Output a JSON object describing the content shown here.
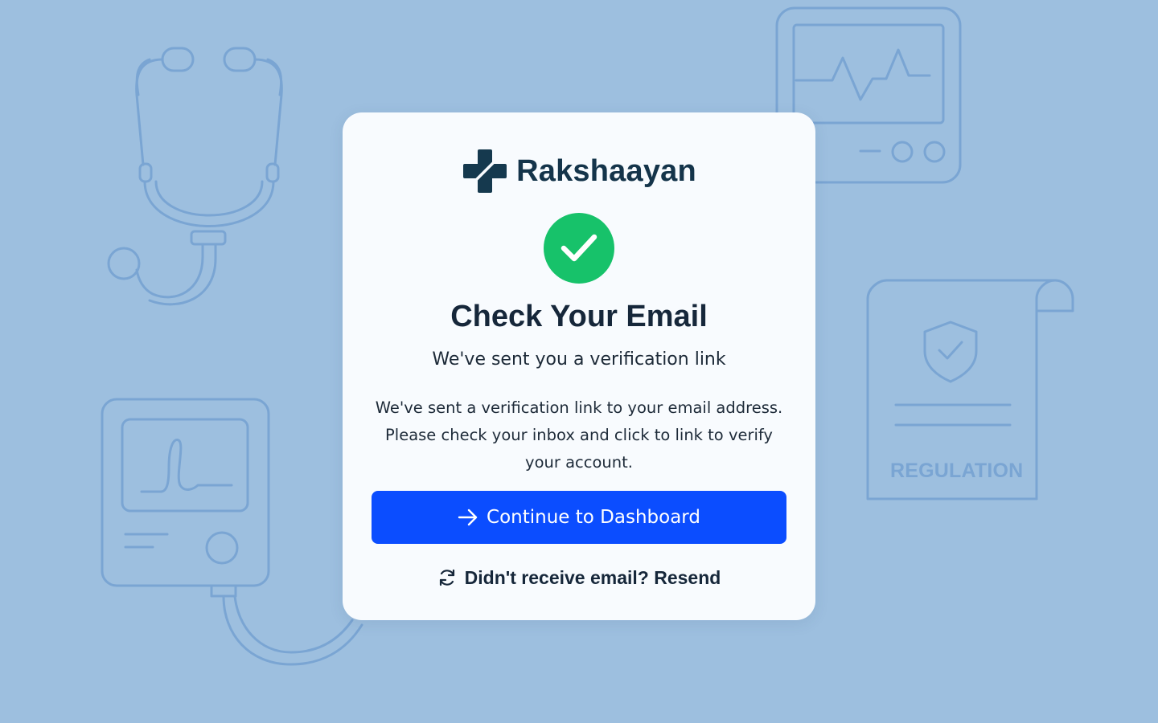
{
  "brand": {
    "name": "Rakshaayan",
    "logo_icon": "medical-cross-icon",
    "logo_color": "#15394e"
  },
  "status": {
    "icon": "check-circle-icon",
    "color": "#17c26a"
  },
  "heading": {
    "title": "Check Your Email",
    "subtitle": "We've sent you a verification link"
  },
  "message": {
    "line1": "We've sent a verification link to your email address.",
    "line2": "Please check your inbox and click to link to verify",
    "line3": "your account."
  },
  "actions": {
    "continue_label": "Continue to Dashboard",
    "continue_icon": "arrow-right-icon",
    "resend_label": "Didn't receive email? Resend",
    "resend_icon": "refresh-icon"
  },
  "background": {
    "regulation_label": "REGULATION",
    "illustrations": [
      "stethoscope-icon",
      "heart-monitor-icon",
      "regulation-document-icon",
      "ecg-device-icon"
    ]
  },
  "colors": {
    "page_background": "#9dbfdf",
    "card_background": "#f8fbfe",
    "primary_button": "#0b4dff",
    "illustration_stroke": "#7aa5d3"
  }
}
